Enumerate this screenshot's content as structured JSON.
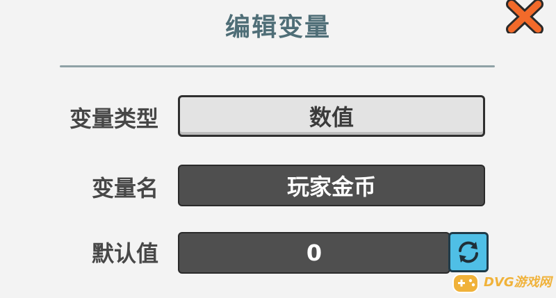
{
  "dialog": {
    "title": "编辑变量",
    "close_icon": "close-x-icon"
  },
  "form": {
    "type_label": "变量类型",
    "type_value": "数值",
    "name_label": "变量名",
    "name_value": "玩家金币",
    "default_label": "默认值",
    "default_value": "0",
    "refresh_icon": "refresh-icon"
  },
  "watermark": {
    "text": "DVG游戏网",
    "sub": "DVG游戏网"
  },
  "colors": {
    "title": "#4f6e77",
    "close": "#f26a2a",
    "dark_field": "#4f4f4f",
    "light_field": "#e3e3e3",
    "refresh_button": "#4fbfe6"
  }
}
